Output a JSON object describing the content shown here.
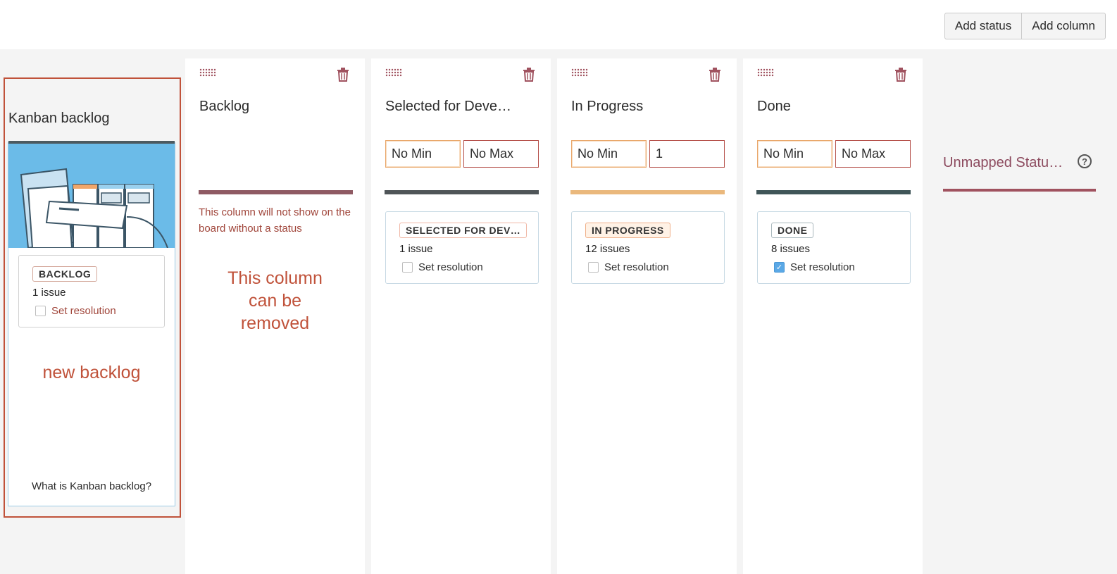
{
  "toolbar": {
    "add_status": "Add status",
    "add_column": "Add column"
  },
  "kanban_backlog": {
    "title": "Kanban backlog",
    "card": {
      "lozenge": "BACKLOG",
      "issues": "1 issue",
      "resolution": "Set resolution",
      "resolution_checked": false
    },
    "note": "new backlog",
    "help_link": "What is Kanban backlog?"
  },
  "columns": [
    {
      "title": "Backlog",
      "warning": "This column will not show on the board without a status",
      "note_lines": [
        "This column",
        "can be",
        "removed"
      ],
      "bar_color": "#8f5a63"
    },
    {
      "title": "Selected for Deve…",
      "min": "No Min",
      "max": "No Max",
      "bar_color": "#4f5558",
      "card": {
        "lozenge": "SELECTED FOR DEV…",
        "issues": "1 issue",
        "resolution": "Set resolution",
        "resolution_checked": false
      }
    },
    {
      "title": "In Progress",
      "min": "No Min",
      "max": "1",
      "bar_color": "#eab87c",
      "card": {
        "lozenge": "IN PROGRESS",
        "issues": "12 issues",
        "resolution": "Set resolution",
        "resolution_checked": false
      }
    },
    {
      "title": "Done",
      "min": "No Min",
      "max": "No Max",
      "bar_color": "#3f5558",
      "card": {
        "lozenge": "DONE",
        "issues": "8 issues",
        "resolution": "Set resolution",
        "resolution_checked": true
      }
    }
  ],
  "unmapped": {
    "title": "Unmapped Statu…",
    "help": "?"
  },
  "colors": {
    "accent_red": "#c0523a",
    "board_bg": "#f4f4f4",
    "checkbox_blue": "#5aa8e6"
  }
}
